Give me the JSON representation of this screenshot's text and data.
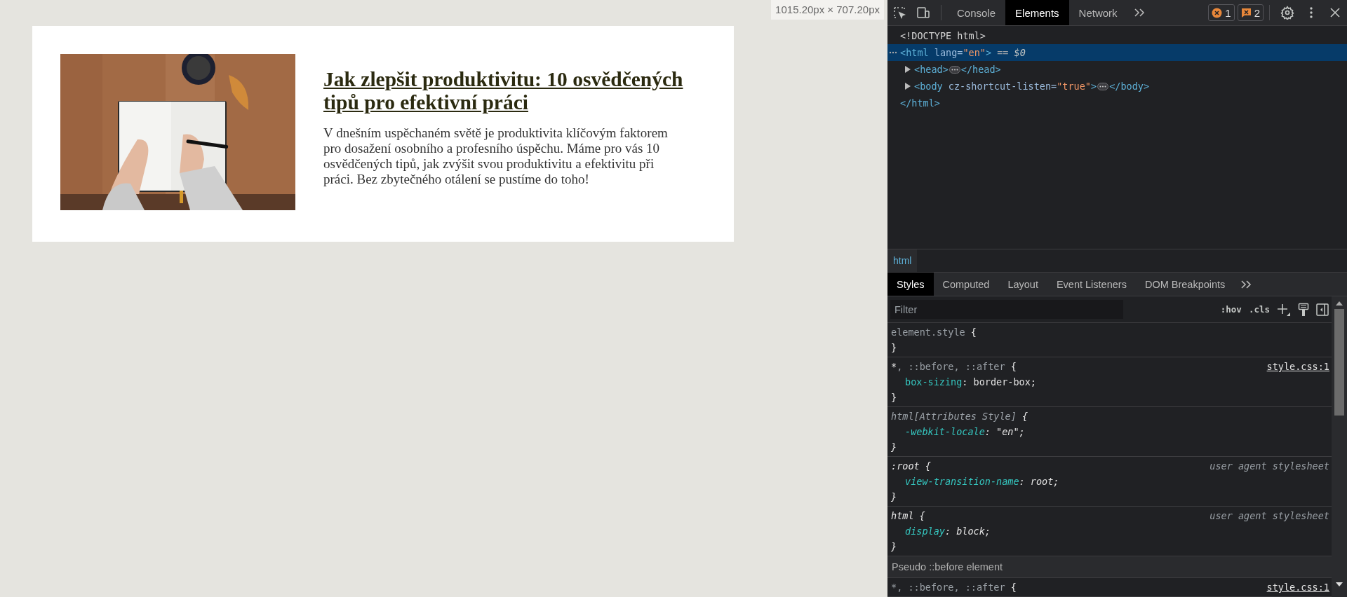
{
  "viewport_size": "1015.20px × 707.20px",
  "article": {
    "title": "Jak zlepšit produktivitu: 10 osvědčených tipů pro efektivní práci",
    "text": "V dnešním uspěchaném světě je produktivita klíčovým faktorem pro dosažení osobního a profesního úspěchu. Máme pro vás 10 osvědčených tipů, jak zvýšit svou produktivitu a efektivitu při práci. Bez zbytečného otálení se pustíme do toho!"
  },
  "devtools": {
    "tabs": [
      {
        "label": "Console",
        "selected": false
      },
      {
        "label": "Elements",
        "selected": true
      },
      {
        "label": "Network",
        "selected": false
      }
    ],
    "errors": "1",
    "warnings": "2",
    "dom": [
      {
        "parts": [
          {
            "kind": "text",
            "text": "<!DOCTYPE html>"
          }
        ]
      },
      {
        "selected": true,
        "parts": [
          {
            "kind": "tag",
            "text": "<html"
          },
          {
            "kind": "attr",
            "text": " lang="
          },
          {
            "kind": "value",
            "text": "\"en\""
          },
          {
            "kind": "tag",
            "text": ">"
          },
          {
            "kind": "muted",
            "text": " == "
          },
          {
            "kind": "muted_italic",
            "text": "$0"
          }
        ],
        "children": [
          {
            "expanded": false,
            "parts": [
              {
                "kind": "tag",
                "text": "<head>"
              },
              {
                "kind": "ellipsis"
              },
              {
                "kind": "tag",
                "text": "</head>"
              }
            ]
          },
          {
            "expanded": false,
            "parts": [
              {
                "kind": "tag",
                "text": "<body"
              },
              {
                "kind": "attr",
                "text": " cz-shortcut-listen="
              },
              {
                "kind": "value",
                "text": "\"true\""
              },
              {
                "kind": "tag",
                "text": ">"
              },
              {
                "kind": "ellipsis"
              },
              {
                "kind": "tag",
                "text": "</body>"
              }
            ]
          }
        ],
        "close": [
          {
            "kind": "tag",
            "text": "</html>"
          }
        ]
      }
    ],
    "breadcrumb": "html",
    "style_tabs": [
      {
        "label": "Styles",
        "selected": true
      },
      {
        "label": "Computed",
        "selected": false
      },
      {
        "label": "Layout",
        "selected": false
      },
      {
        "label": "Event Listeners",
        "selected": false
      },
      {
        "label": "DOM Breakpoints",
        "selected": false
      }
    ],
    "filter": {
      "placeholder": "Filter"
    },
    "hov": ":hov",
    "cls": ".cls",
    "styles": [
      {
        "kind": "inline",
        "selector": [
          {
            "text": "element.style",
            "matched": false
          }
        ],
        "open": "{",
        "close": "}"
      },
      {
        "kind": "author",
        "source": "style.css:1",
        "selector": [
          {
            "text": "*",
            "matched": true
          },
          {
            "text": ", ::before, ::after",
            "matched": false
          }
        ],
        "open": "{",
        "declarations": [
          {
            "property": "box-sizing",
            "colon": ":",
            "value": "border-box;"
          }
        ],
        "close": "}"
      },
      {
        "kind": "attributes",
        "selector": [
          {
            "text": "html[Attributes Style]",
            "matched": false
          }
        ],
        "open": "{",
        "declarations": [
          {
            "property": "-webkit-locale",
            "colon": ":",
            "value": "\"en\";"
          }
        ],
        "close": "}"
      },
      {
        "kind": "useragent",
        "source": "user agent stylesheet",
        "selector": [
          {
            "text": ":root",
            "matched": true
          }
        ],
        "open": "{",
        "declarations": [
          {
            "property": "view-transition-name",
            "colon": ":",
            "value": "root;"
          }
        ],
        "close": "}"
      },
      {
        "kind": "useragent",
        "source": "user agent stylesheet",
        "selector": [
          {
            "text": "html",
            "matched": true
          }
        ],
        "open": "{",
        "declarations": [
          {
            "property": "display",
            "colon": ":",
            "value": "block;"
          }
        ],
        "close": "}"
      },
      {
        "kind": "header",
        "text": "Pseudo ::before element"
      },
      {
        "kind": "author",
        "source": "style.css:1",
        "selector": [
          {
            "text": "*",
            "matched": false
          },
          {
            "text": ", ::before, ::after",
            "matched": false
          }
        ],
        "open": "{"
      }
    ]
  }
}
